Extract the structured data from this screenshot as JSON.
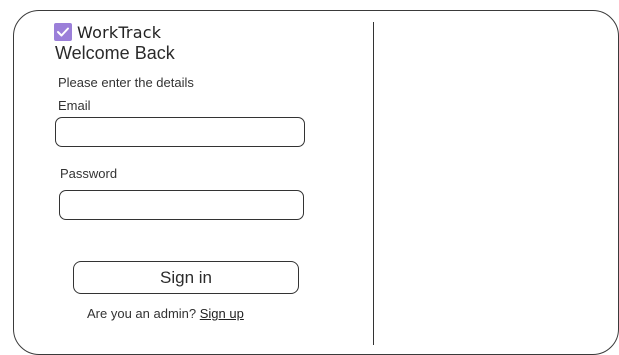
{
  "brand": {
    "name": "WorkTrack",
    "icon": "check-icon",
    "accent_color": "#9b7fd9"
  },
  "login": {
    "title": "Welcome Back",
    "subtitle": "Please enter the details",
    "email_label": "Email",
    "email_value": "",
    "password_label": "Password",
    "password_value": "",
    "sign_in_label": "Sign in",
    "admin_prompt": "Are you an admin?",
    "sign_up_label": "Sign up"
  }
}
